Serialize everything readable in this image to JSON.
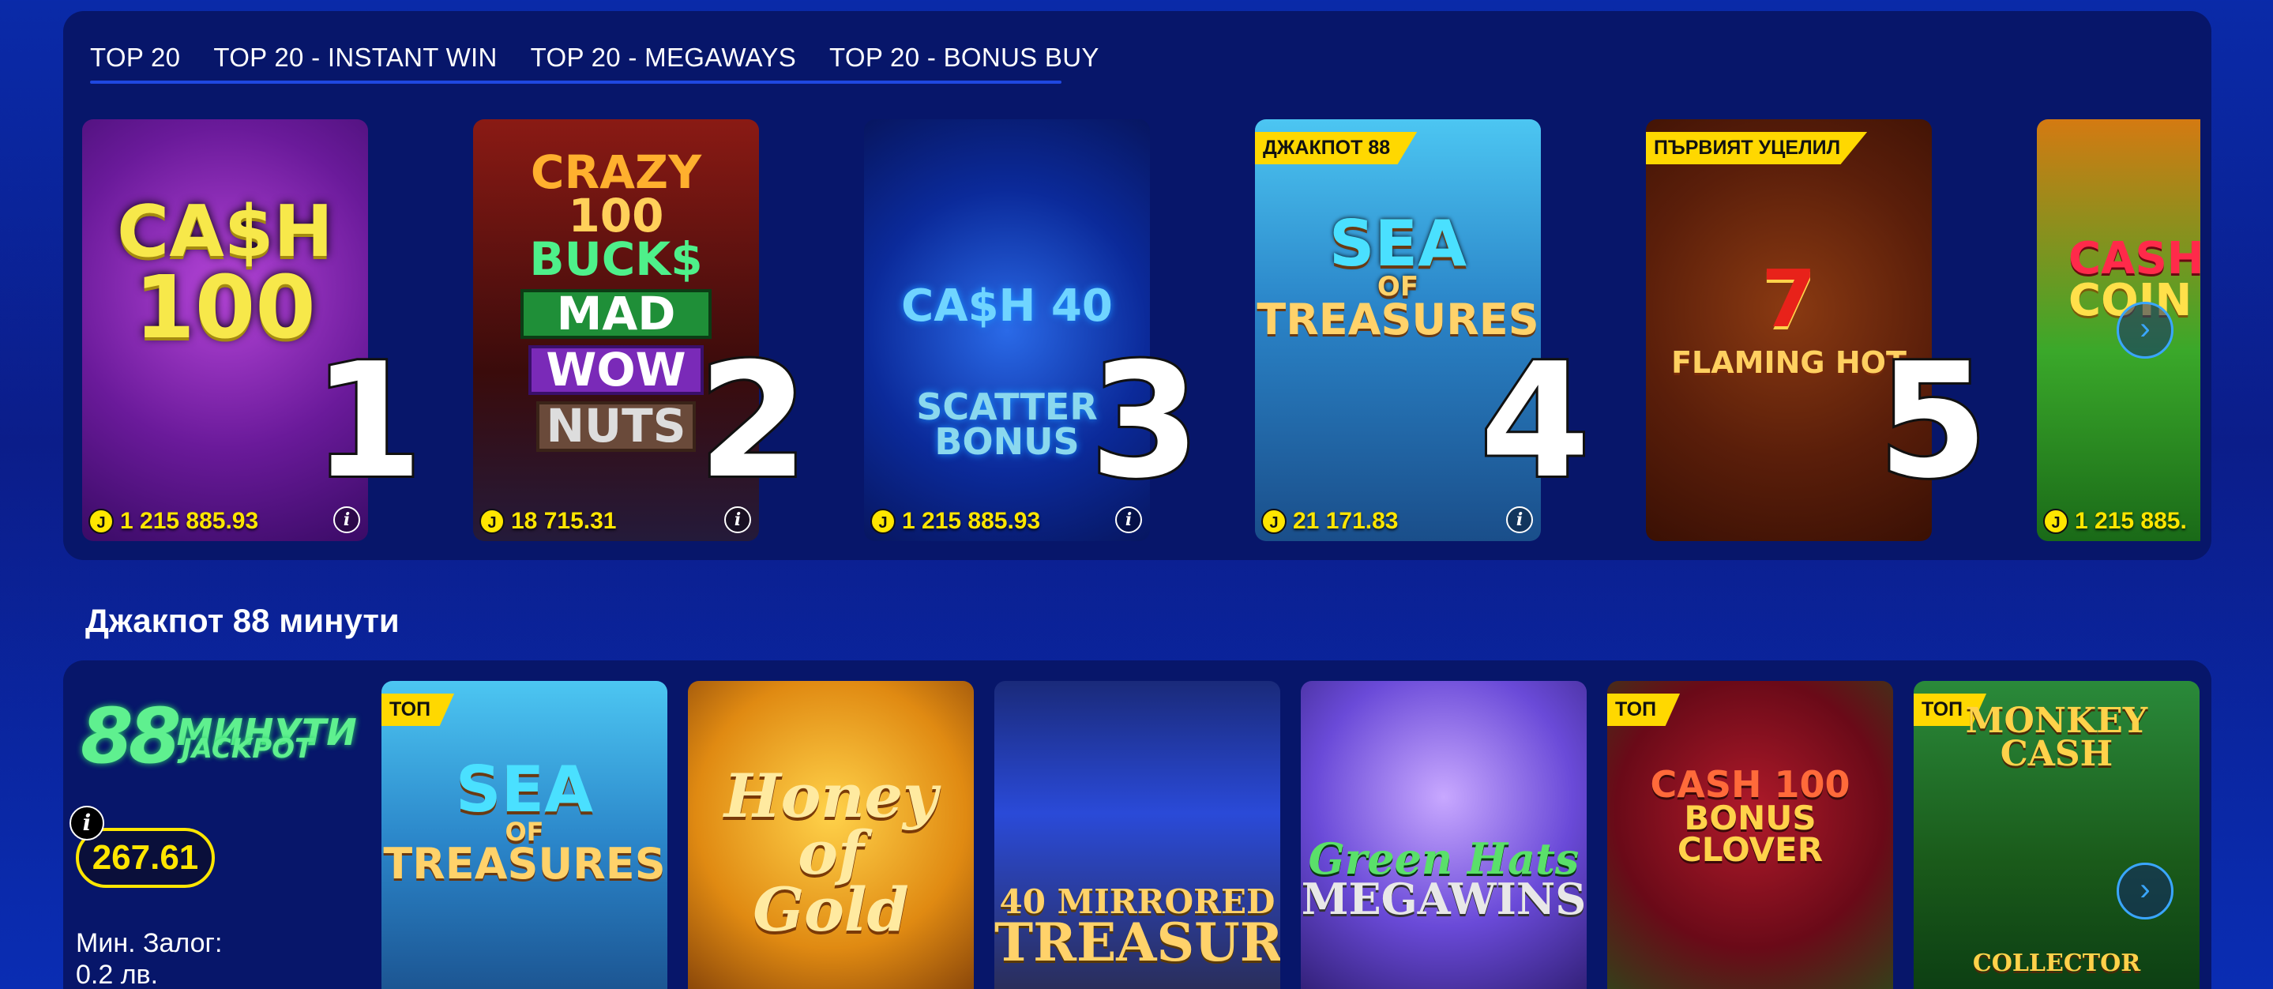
{
  "tabs": [
    "TOP 20",
    "TOP 20 - INSTANT WIN",
    "TOP 20 - MEGAWAYS",
    "TOP 20 - BONUS BUY"
  ],
  "top_games": [
    {
      "rank": "1",
      "title_lines": [
        "CA$H",
        "100"
      ],
      "jackpot": "1 215 885.93",
      "badge": ""
    },
    {
      "rank": "2",
      "title_lines": [
        "CRAZY",
        "100",
        "BUCK$",
        "MAD",
        "WOW",
        "NUTS"
      ],
      "jackpot": "18 715.31",
      "badge": ""
    },
    {
      "rank": "3",
      "title_lines": [
        "CA$H 40",
        "SCATTER",
        "BONUS"
      ],
      "jackpot": "1 215 885.93",
      "badge": ""
    },
    {
      "rank": "4",
      "title_lines": [
        "SEA",
        "OF",
        "TREASURES"
      ],
      "jackpot": "21 171.83",
      "badge": "ДЖАКПОТ 88"
    },
    {
      "rank": "5",
      "title_lines": [
        "FLAMING HOT"
      ],
      "jackpot": "",
      "badge": "ПЪРВИЯТ УЦЕЛИЛ"
    },
    {
      "rank": "",
      "title_lines": [
        "CASH",
        "COIN CL"
      ],
      "jackpot": "1 215 885.",
      "badge": ""
    }
  ],
  "jackpot_section": {
    "title": "Джакпот 88 минути",
    "logo_number": "88",
    "logo_word": "МИНУТИ",
    "logo_sub": "JACKPOT",
    "amount": "267.61",
    "min_bet_label": "Мин. Залог:",
    "min_bet_value": "0.2 лв.",
    "info_symbol": "i",
    "games": [
      {
        "badge": "ТОП",
        "title_lines": [
          "SEA",
          "OF",
          "TREASURES"
        ]
      },
      {
        "badge": "",
        "title_lines": [
          "Honey of",
          "Gold"
        ]
      },
      {
        "badge": "",
        "title_lines": [
          "40 MIRRORED",
          "TREASURES"
        ]
      },
      {
        "badge": "",
        "title_lines": [
          "Green Hats",
          "MEGAWINS"
        ]
      },
      {
        "badge": "ТОП",
        "title_lines": [
          "CASH 100",
          "BONUS CLOVER"
        ]
      },
      {
        "badge": "ТОП",
        "title_lines": [
          "MONKEY CASH",
          "COLLECTOR"
        ]
      }
    ]
  },
  "icons": {
    "jackpot": "J",
    "info": "i",
    "arrow_right": "›"
  },
  "colors": {
    "accent": "#ffe600",
    "panel": "#07166a",
    "arrow": "#3aa6ff",
    "logo_green": "#5ff08f"
  }
}
